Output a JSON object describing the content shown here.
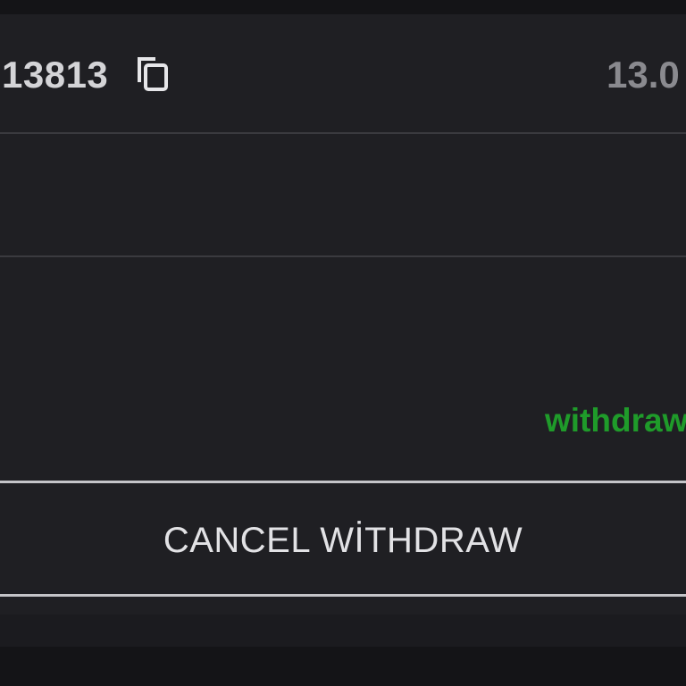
{
  "transaction": {
    "id": "13813",
    "amount": "13.0",
    "copy_icon": "copy-icon"
  },
  "status": {
    "text": "withdraw",
    "color": "#1f9b2a"
  },
  "actions": {
    "cancel_label": "CANCEL WİTHDRAW"
  },
  "colors": {
    "background": "#141417",
    "card": "#1f1f23",
    "divider": "#3a3a3f",
    "button_border": "#c4c4c8"
  }
}
